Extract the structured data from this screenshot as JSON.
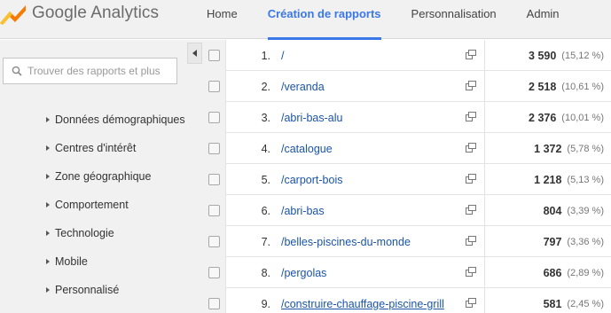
{
  "app": {
    "title": "Google Analytics"
  },
  "nav": {
    "tabs": [
      {
        "label": "Home"
      },
      {
        "label": "Création de rapports",
        "active": true
      },
      {
        "label": "Personnalisation"
      },
      {
        "label": "Admin"
      }
    ]
  },
  "sidebar": {
    "search_placeholder": "Trouver des rapports et plus",
    "items": [
      {
        "label": "Données démographiques"
      },
      {
        "label": "Centres d'intérêt"
      },
      {
        "label": "Zone géographique"
      },
      {
        "label": "Comportement"
      },
      {
        "label": "Technologie"
      },
      {
        "label": "Mobile"
      },
      {
        "label": "Personnalisé"
      }
    ]
  },
  "table": {
    "rows": [
      {
        "index": "1.",
        "page": "/",
        "value": "3 590",
        "percent": "(15,12 %)"
      },
      {
        "index": "2.",
        "page": "/veranda",
        "value": "2 518",
        "percent": "(10,61 %)"
      },
      {
        "index": "3.",
        "page": "/abri-bas-alu",
        "value": "2 376",
        "percent": "(10,01 %)"
      },
      {
        "index": "4.",
        "page": "/catalogue",
        "value": "1 372",
        "percent": "(5,78 %)"
      },
      {
        "index": "5.",
        "page": "/carport-bois",
        "value": "1 218",
        "percent": "(5,13 %)"
      },
      {
        "index": "6.",
        "page": "/abri-bas",
        "value": "804",
        "percent": "(3,39 %)"
      },
      {
        "index": "7.",
        "page": "/belles-piscines-du-monde",
        "value": "797",
        "percent": "(3,36 %)"
      },
      {
        "index": "8.",
        "page": "/pergolas",
        "value": "686",
        "percent": "(2,89 %)"
      },
      {
        "index": "9.",
        "page": "/construire-chauffage-piscine-grill",
        "value": "581",
        "percent": "(2,45 %)",
        "hovered": true
      }
    ]
  },
  "colors": {
    "accent": "#3b78e7",
    "link": "#1a55a8",
    "logo_orange": "#f57c00",
    "logo_yellow": "#fbc02d"
  },
  "icons": {
    "logo": "analytics-logo-icon",
    "search": "search-icon",
    "row_open": "open-in-new-window-icon",
    "sidebar_collapse": "collapse-left-icon",
    "menu_caret": "caret-right-icon"
  }
}
